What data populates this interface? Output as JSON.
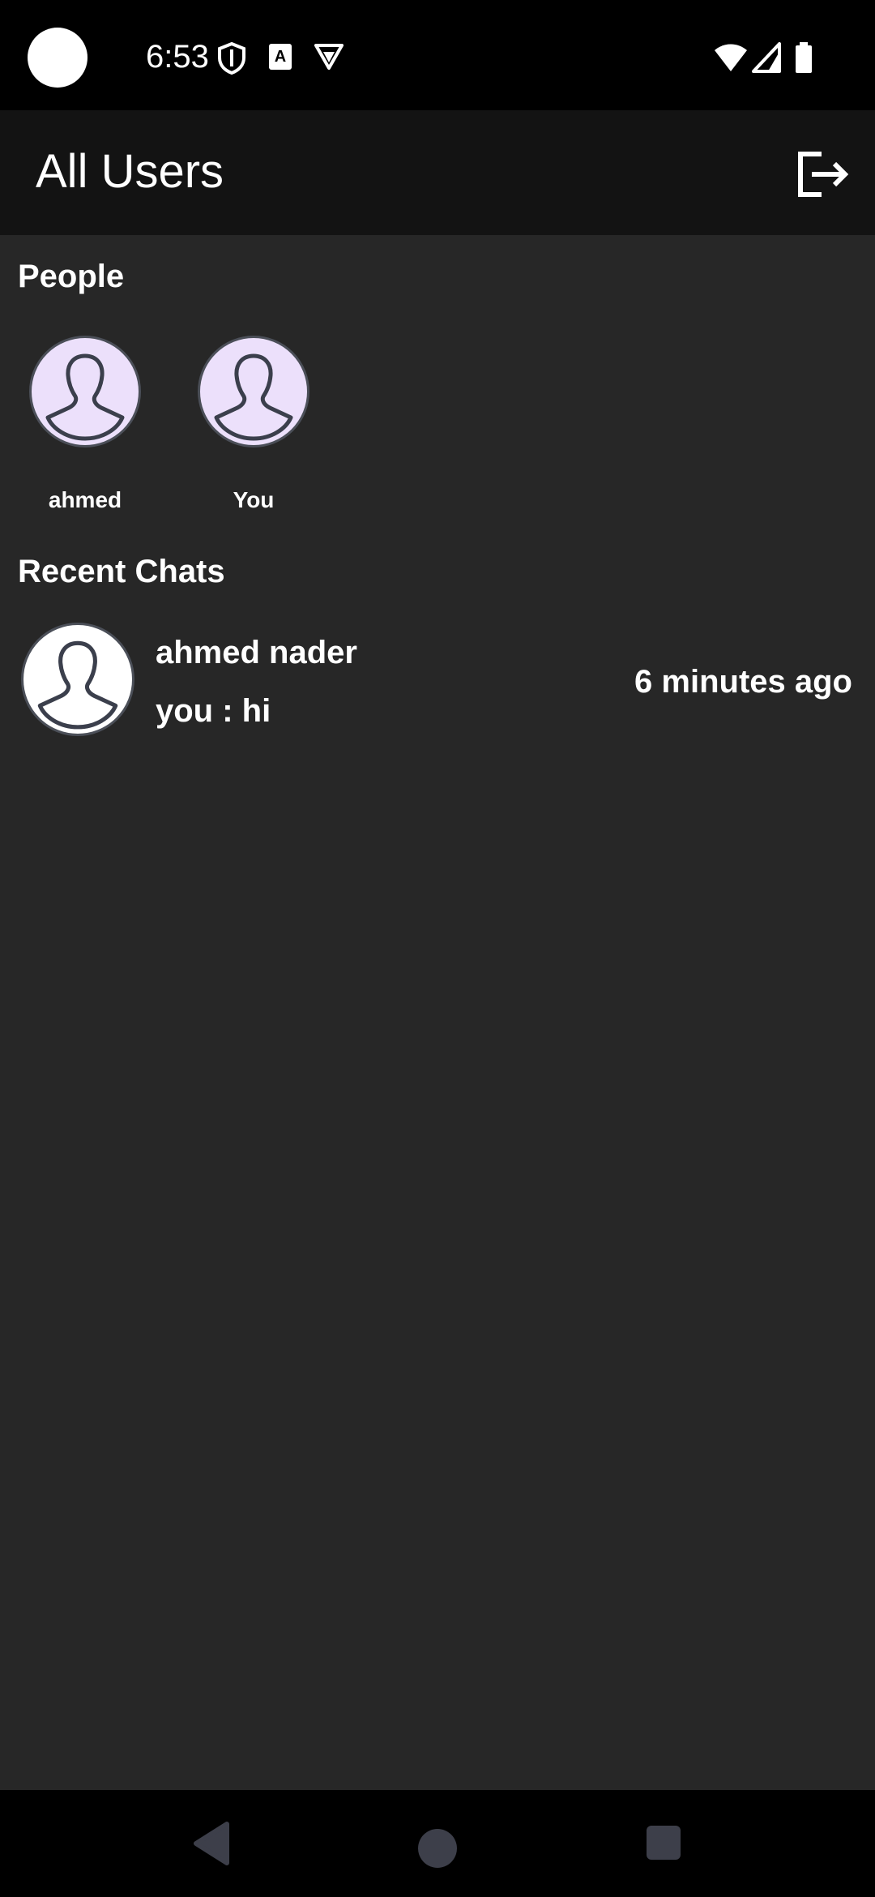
{
  "status_bar": {
    "time": "6:53",
    "icons": [
      "shield-icon",
      "text-a-icon",
      "vpn-icon",
      "wifi-icon",
      "signal-icon",
      "battery-icon"
    ]
  },
  "app_bar": {
    "title": "All Users",
    "logout_icon": "logout-icon"
  },
  "people_section": {
    "title": "People",
    "people": [
      {
        "name": "ahmed",
        "avatar": "person-avatar-icon"
      },
      {
        "name": "You",
        "avatar": "person-avatar-icon"
      }
    ]
  },
  "recent_section": {
    "title": "Recent Chats",
    "chats": [
      {
        "name": "ahmed nader",
        "message": "you : hi",
        "time": "6 minutes ago"
      }
    ]
  },
  "nav_bar": {
    "icons": [
      "back-icon",
      "home-icon",
      "recents-icon"
    ]
  },
  "colors": {
    "background": "#272727",
    "app_bar": "#131313",
    "avatar_fill": "#ece0fb"
  }
}
